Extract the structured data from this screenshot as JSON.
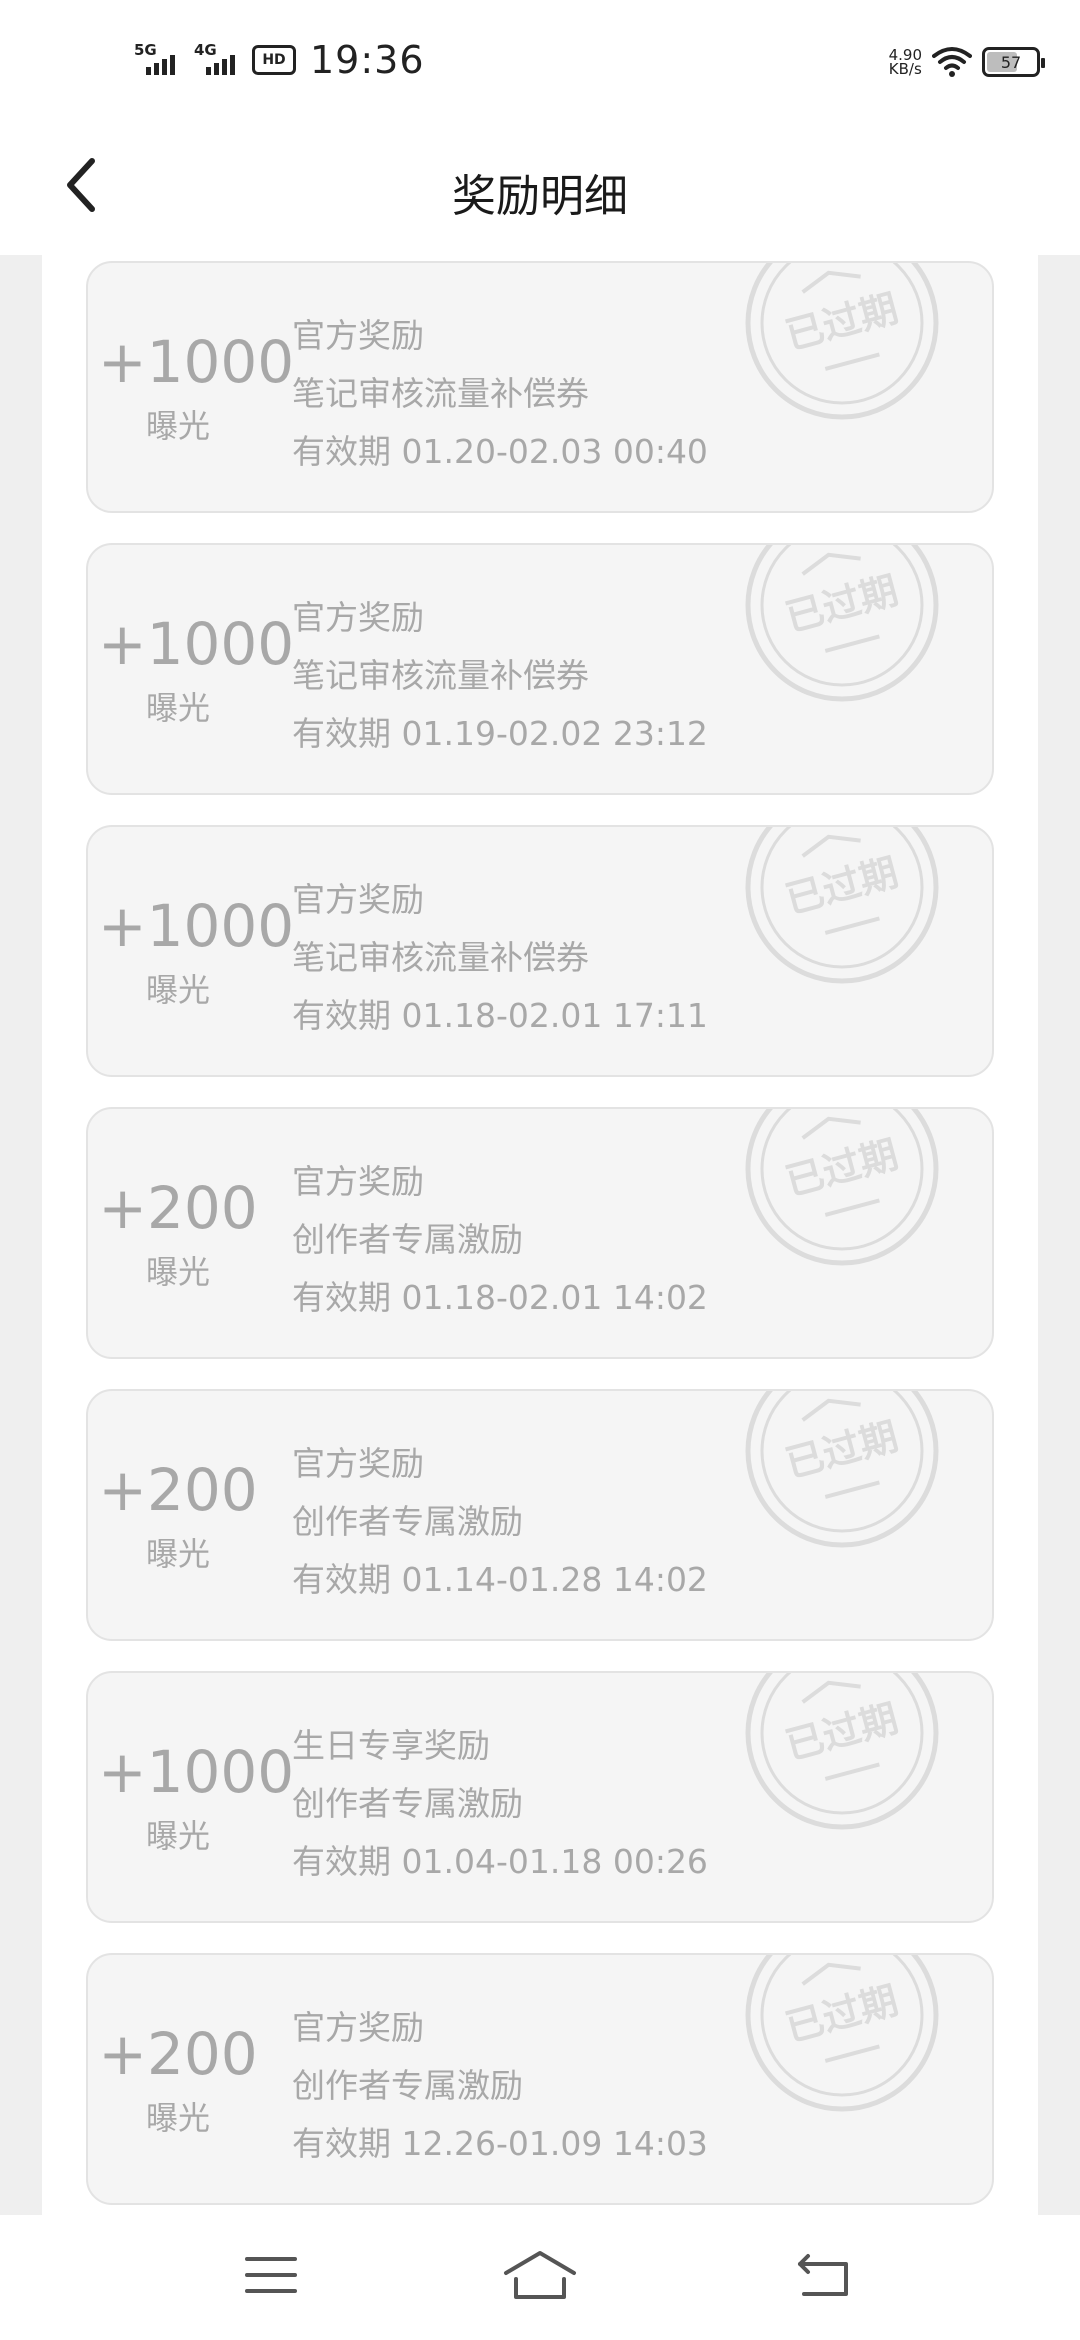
{
  "status_bar": {
    "sim1": "5G",
    "sim2": "4G",
    "hd": "HD",
    "time": "19:36",
    "speed_value": "4.90",
    "speed_unit": "KB/s",
    "battery": "57"
  },
  "header": {
    "title": "奖励明细"
  },
  "stamp_text": "已过期",
  "rewards": [
    {
      "amount": "+1000",
      "unit": "曝光",
      "source": "官方奖励",
      "name": "笔记审核流量补偿券",
      "validity": "有效期 01.20-02.03 00:40"
    },
    {
      "amount": "+1000",
      "unit": "曝光",
      "source": "官方奖励",
      "name": "笔记审核流量补偿券",
      "validity": "有效期 01.19-02.02 23:12"
    },
    {
      "amount": "+1000",
      "unit": "曝光",
      "source": "官方奖励",
      "name": "笔记审核流量补偿券",
      "validity": "有效期 01.18-02.01 17:11"
    },
    {
      "amount": "+200",
      "unit": "曝光",
      "source": "官方奖励",
      "name": "创作者专属激励",
      "validity": "有效期 01.18-02.01 14:02"
    },
    {
      "amount": "+200",
      "unit": "曝光",
      "source": "官方奖励",
      "name": "创作者专属激励",
      "validity": "有效期 01.14-01.28 14:02"
    },
    {
      "amount": "+1000",
      "unit": "曝光",
      "source": "生日专享奖励",
      "name": "创作者专属激励",
      "validity": "有效期 01.04-01.18 00:26"
    },
    {
      "amount": "+200",
      "unit": "曝光",
      "source": "官方奖励",
      "name": "创作者专属激励",
      "validity": "有效期 12.26-01.09 14:03"
    }
  ],
  "icons": {
    "back": "chevron-left-icon",
    "menu": "menu-icon",
    "home": "home-icon",
    "return": "return-icon"
  },
  "colors": {
    "card_bg": "#f5f5f5",
    "card_border": "#e3e3e3",
    "muted_text": "#a8a8a8",
    "stamp": "#dcdcdc",
    "rail": "#efefef"
  }
}
